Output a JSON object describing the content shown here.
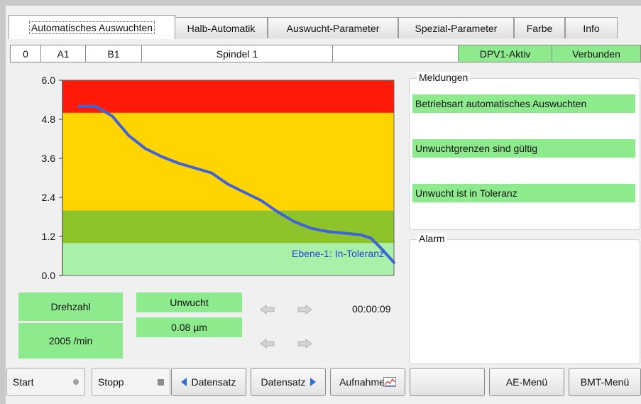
{
  "tabs": [
    {
      "label": "Automatisches Auswuchten",
      "active": true
    },
    {
      "label": "Halb-Automatik"
    },
    {
      "label": "Auswucht-Parameter"
    },
    {
      "label": "Spezial-Parameter"
    },
    {
      "label": "Farbe"
    },
    {
      "label": "Info"
    }
  ],
  "status": {
    "c0": "0",
    "c1": "A1",
    "c2": "B1",
    "spindle": "Spindel 1",
    "empty": "",
    "dpv": "DPV1-Aktiv",
    "connection": "Verbunden"
  },
  "chart_data": {
    "type": "line",
    "ylim": [
      0,
      6
    ],
    "yticks": [
      "0.0",
      "1.2",
      "2.4",
      "3.6",
      "4.8",
      "6.0"
    ],
    "zones": [
      {
        "from": 0,
        "to": 1.0,
        "color": "#a9f0a9"
      },
      {
        "from": 1.0,
        "to": 2.0,
        "color": "#8ec42a"
      },
      {
        "from": 2.0,
        "to": 5.0,
        "color": "#ffd400"
      },
      {
        "from": 5.0,
        "to": 6.0,
        "color": "#ff1a0a"
      }
    ],
    "line_color": "#3f63d8",
    "annotation": "Ebene-1: In-Toleranz",
    "series": [
      {
        "x": [
          0.05,
          0.1,
          0.15,
          0.2,
          0.25,
          0.3,
          0.35,
          0.4,
          0.45,
          0.5,
          0.55,
          0.6,
          0.65,
          0.7,
          0.75,
          0.8,
          0.85,
          0.9,
          0.93,
          0.96,
          1.0
        ],
        "y": [
          5.2,
          5.2,
          4.9,
          4.3,
          3.9,
          3.65,
          3.45,
          3.3,
          3.15,
          2.8,
          2.55,
          2.3,
          1.95,
          1.65,
          1.45,
          1.35,
          1.3,
          1.25,
          1.15,
          0.85,
          0.4
        ]
      }
    ]
  },
  "values": {
    "speed_label": "Drehzahl",
    "speed_value": "2005  /min",
    "unbalance_label": "Unwucht",
    "unbalance_value": "0.08 µm",
    "timer": "00:00:09"
  },
  "messages": {
    "title": "Meldungen",
    "items": [
      "Betriebsart automatisches Auswuchten",
      "Unwuchtgrenzen sind gültig",
      "Unwucht ist in Toleranz"
    ]
  },
  "alarm": {
    "title": "Alarm"
  },
  "buttons": {
    "start": "Start",
    "stop": "Stopp",
    "prev_record": "Datensatz",
    "next_record": "Datensatz",
    "record": "Aufnahme",
    "blank": "",
    "ae_menu": "AE-Menü",
    "bmt_menu": "BMT-Menü"
  }
}
